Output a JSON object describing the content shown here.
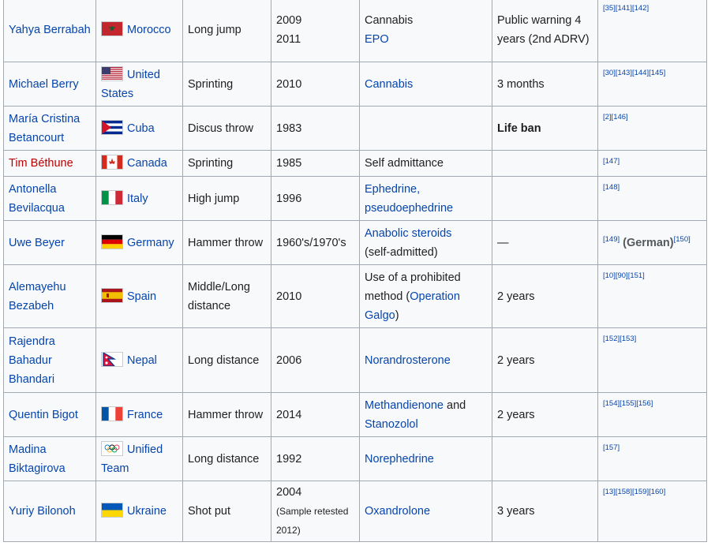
{
  "rows": [
    {
      "name": "Yahya Berrabah",
      "name_style": "blue",
      "country": "Morocco",
      "flag": "morocco",
      "event": "Long jump",
      "years": [
        "2009",
        "2011"
      ],
      "subs": [
        {
          "text": "Cannabis",
          "link": false
        },
        {
          "text": "EPO",
          "link": true
        }
      ],
      "penalty": "Public warning 4 years (2nd ADRV)",
      "refs": "[35][141][142]"
    },
    {
      "name": "Michael Berry",
      "name_style": "blue",
      "country": "United States",
      "flag": "usa",
      "event": "Sprinting",
      "years": [
        "2010"
      ],
      "subs": [
        {
          "text": "Cannabis",
          "link": true
        }
      ],
      "penalty": "3 months",
      "refs": "[30][143][144][145]"
    },
    {
      "name": "María Cristina Betancourt",
      "name_style": "blue",
      "country": "Cuba",
      "flag": "cuba",
      "event": "Discus throw",
      "years": [
        "1983"
      ],
      "subs": [],
      "penalty": "Life ban",
      "penalty_bold": true,
      "refs": "[2][146]"
    },
    {
      "name": "Tim Béthune",
      "name_style": "red",
      "country": "Canada",
      "flag": "canada",
      "event": "Sprinting",
      "years": [
        "1985"
      ],
      "subs": [
        {
          "text": "Self admittance",
          "link": false
        }
      ],
      "penalty": "",
      "refs": "[147]"
    },
    {
      "name": "Antonella Bevilacqua",
      "name_style": "blue",
      "country": "Italy",
      "flag": "italy",
      "event": "High jump",
      "years": [
        "1996"
      ],
      "subs": [
        {
          "text": "Ephedrine, pseudoephedrine",
          "link": true
        }
      ],
      "penalty": "",
      "refs": "[148]"
    },
    {
      "name": "Uwe Beyer",
      "name_style": "blue",
      "country": "Germany",
      "flag": "germany",
      "event": "Hammer throw",
      "years": [
        "1960's/1970's"
      ],
      "subs": [
        {
          "text": "Anabolic steroids",
          "link": true
        },
        {
          "text": "(self-admitted)",
          "link": false
        }
      ],
      "penalty": "—",
      "refs": "[149]",
      "refs_note": "(German)",
      "refs2": "[150]"
    },
    {
      "name": "Alemayehu Bezabeh",
      "name_style": "blue",
      "country": "Spain",
      "flag": "spain",
      "event": "Middle/Long distance",
      "years": [
        "2010"
      ],
      "subs_html": "Use of a prohibited method (<a class=\"lnk\">Operation Galgo</a>)",
      "subs": [
        {
          "text": "Use of a prohibited method (",
          "link": false
        },
        {
          "text": "Operation Galgo",
          "link": true
        },
        {
          "text": ")",
          "link": false
        }
      ],
      "penalty": "2 years",
      "refs": "[10][90][151]"
    },
    {
      "name": "Rajendra Bahadur Bhandari",
      "name_style": "blue",
      "country": "Nepal",
      "flag": "nepal",
      "event": "Long distance",
      "years": [
        "2006"
      ],
      "subs": [
        {
          "text": "Norandrosterone",
          "link": true
        }
      ],
      "penalty": "2 years",
      "refs": "[152][153]"
    },
    {
      "name": "Quentin Bigot",
      "name_style": "blue",
      "country": "France",
      "flag": "france",
      "event": "Hammer throw",
      "years": [
        "2014"
      ],
      "subs": [
        {
          "text": "Methandienone",
          "link": true
        },
        {
          "text": " and ",
          "link": false
        },
        {
          "text": "Stanozolol",
          "link": true
        }
      ],
      "penalty": "2 years",
      "refs": "[154][155][156]"
    },
    {
      "name": "Madina Biktagirova",
      "name_style": "blue",
      "country": "Unified Team",
      "flag": "olympic",
      "event": "Long distance",
      "years": [
        "1992"
      ],
      "subs": [
        {
          "text": "Norephedrine",
          "link": true
        }
      ],
      "penalty": "",
      "refs": "[157]"
    },
    {
      "name": "Yuriy Bilonoh",
      "name_style": "blue",
      "country": "Ukraine",
      "flag": "ukraine",
      "event": "Shot put",
      "years": [
        "2004"
      ],
      "year_note": "(Sample retested 2012)",
      "subs": [
        {
          "text": "Oxandrolone",
          "link": true
        }
      ],
      "penalty": "3 years",
      "refs": "[13][158][159][160]"
    }
  ],
  "colors": {
    "link": "#0645ad",
    "redlink": "#ba0000",
    "border": "#a2a9b1",
    "cell_bg": "#f8f9fa"
  }
}
